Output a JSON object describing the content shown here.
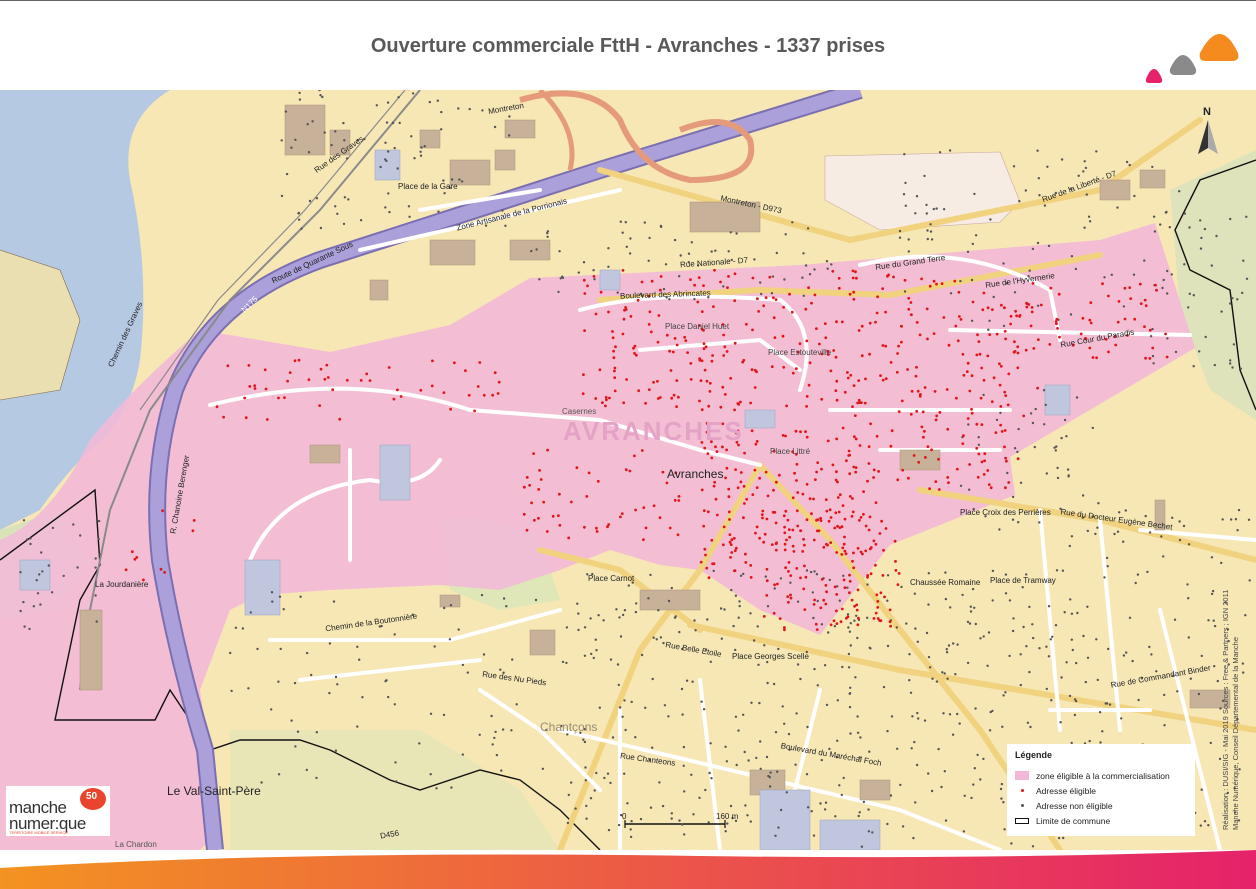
{
  "title": "Ouverture commerciale FttH - Avranches - 1337 prises",
  "colors": {
    "zone": "#f3b8d8",
    "eligible": "#e0161b",
    "non_eligible": "#555555",
    "water": "#b5c9e3",
    "land": "#f6e7b5",
    "major_road": "#a99cd6",
    "footer_start": "#f39321",
    "footer_end": "#e5226a"
  },
  "map": {
    "town_label": "AVRANCHES",
    "commune_label": "Avranches",
    "neighbour_label": "Le Val-Saint-Père",
    "hamlet_label": "Chantçons",
    "places": [
      "Place de la Gare",
      "Place Daniel Huet",
      "Place Estouteville",
      "Place Littré",
      "Place Carnot",
      "Place Georges Scelle",
      "Place de Tramway",
      "Chaussée Romaine",
      "Place Croix des Perrières",
      "La Jourdanière",
      "La Chardon",
      "Casernes"
    ],
    "streets": [
      "Rue des Graves",
      "Montreton",
      "Zone Artisanale de la Porrionais",
      "Montreton - D973",
      "Rue de la Liberté - D7",
      "Rue Nationale - D7",
      "Rue du Grand Terre",
      "Boulevard des Abrincates",
      "Rue de l'Hyvernerie",
      "Rue Cour du Paradis",
      "Rue du Docteur Eugène Bechet",
      "Boulevard du Maréchal Foch",
      "Rue de Commandant Binder",
      "Rue Chanteons",
      "Chemin de la Boutonnière",
      "Rue des Nu Pieds",
      "Rue Belle Etoile",
      "R. Chanoine Berenger",
      "Route de Quarante Sous",
      "Chemin des Graves",
      "N175",
      "D456"
    ],
    "scale_label": "160 m",
    "scale_zero": "0",
    "north": "N"
  },
  "legend": {
    "title": "Légende",
    "items": [
      {
        "label": "zone éligible à la commercialisation",
        "symbol": "zone"
      },
      {
        "label": "Adresse éligible",
        "symbol": "dot-red"
      },
      {
        "label": "Adresse non éligible",
        "symbol": "dot-grey"
      },
      {
        "label": "Limite de commune",
        "symbol": "limit"
      }
    ]
  },
  "brand": {
    "line1": "manche",
    "line2": "numer:que",
    "badge": "50",
    "tagline": "TERRITOIRE MOBILE SERVICE"
  },
  "credits": {
    "line1": "Réalisation : DUSI/SIG - Mai 2019 Sources : Free & Partners ; IGN 2011",
    "line2": "Manche Numérique, Conseil Départemental de la Manche"
  }
}
